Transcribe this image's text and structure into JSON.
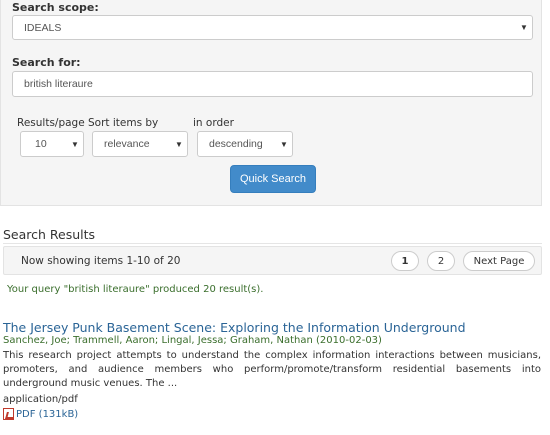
{
  "search": {
    "scope_label": "Search scope:",
    "scope_value": "IDEALS",
    "query_label": "Search for:",
    "query_value": "british literaure",
    "results_per_page_label": "Results/page",
    "results_per_page_value": "10",
    "sort_label": "Sort items by",
    "sort_value": "relevance",
    "order_label": "in order",
    "order_value": "descending",
    "submit_label": "Quick Search"
  },
  "results": {
    "heading": "Search Results",
    "showing_text": "Now showing items 1-10 of 20",
    "pages": [
      "1",
      "2"
    ],
    "next_label": "Next Page",
    "query_message": "Your query \"british literaure\" produced 20 result(s).",
    "items": [
      {
        "title": "The Jersey Punk Basement Scene: Exploring the Information Underground",
        "authors": "Sanchez, Joe; Trammell, Aaron; Lingal, Jessa; Graham, Nathan (2010-02-03)",
        "abstract": "This research project attempts to understand the complex information interactions between musicians, promoters, and audience members who perform/promote/transform residential basements into underground music venues. The ...",
        "format": "application/pdf",
        "file_label": "PDF (131kB)"
      }
    ]
  },
  "icons": {
    "select_caret": "▼",
    "file": "pdf-icon"
  }
}
